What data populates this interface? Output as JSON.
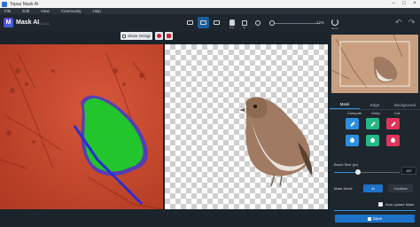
{
  "window": {
    "title": "Topaz Mask AI",
    "controls": [
      "–",
      "□",
      "×"
    ]
  },
  "menu": {
    "items": [
      "File",
      "Edit",
      "View",
      "Community",
      "Help"
    ]
  },
  "header": {
    "app_name": "Mask AI",
    "version": "v1.2.4",
    "zoom": "17%",
    "tool_labels": {
      "pan": "Pan",
      "fit": "Fit",
      "reset": "Reset"
    }
  },
  "view_options": {
    "show_original_label": "Show Orinigl"
  },
  "panel": {
    "tabs": [
      "Mask",
      "Edge",
      "Background"
    ],
    "active_tab": "Mask",
    "tool_columns": [
      "Compute",
      "Keep",
      "Cut"
    ],
    "brush_size_label": "Brush Size (px)",
    "brush_size_value": "187",
    "brush_size_fraction": 0.35,
    "mask_mode_label": "Mask Mode",
    "mask_mode_options": [
      "AI",
      "Contrast"
    ],
    "mask_mode_selected": "AI",
    "auto_update_label": "Auto update Mask",
    "save_label": "Save"
  },
  "colors": {
    "accent_blue": "#2b8fe0",
    "keep_green": "#23b884",
    "cut_red": "#e0345a",
    "mask_overlay_green": "#22c52c",
    "background_overlay": "#c5492a"
  },
  "icons": [
    "app-logo-icon",
    "pan-hand-icon",
    "reset-icon",
    "undo-icon",
    "redo-icon",
    "pen-icon",
    "fill-icon",
    "save-icon"
  ]
}
